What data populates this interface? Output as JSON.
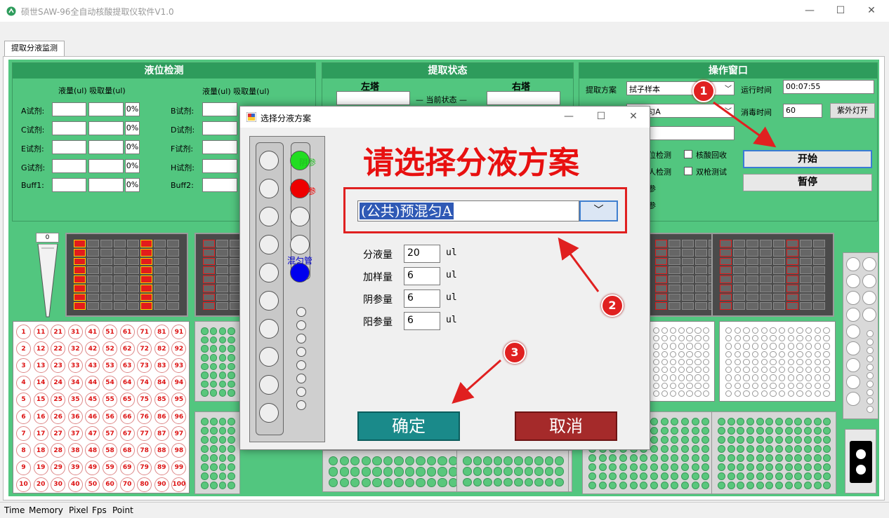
{
  "window": {
    "title": "硕世SAW-96全自动核酸提取仪软件V1.0",
    "min": "—",
    "max": "☐",
    "close": "✕"
  },
  "tabs": [
    {
      "label": "提取分液监测"
    }
  ],
  "liquid": {
    "title": "液位检测",
    "col1_header": "液量(ul) 吸取量(ul)",
    "col2_header": "液量(ul) 吸取量(ul)",
    "left_rows": [
      {
        "label": "A试剂:",
        "pct": "0%"
      },
      {
        "label": "C试剂:",
        "pct": "0%"
      },
      {
        "label": "E试剂:",
        "pct": "0%"
      },
      {
        "label": "G试剂:",
        "pct": "0%"
      },
      {
        "label": "Buff1:",
        "pct": "0%"
      }
    ],
    "right_rows": [
      {
        "label": "B试剂:"
      },
      {
        "label": "D试剂:"
      },
      {
        "label": "F试剂:"
      },
      {
        "label": "H试剂:"
      },
      {
        "label": "Buff2:"
      }
    ]
  },
  "extract": {
    "title": "提取状态",
    "left": "左塔",
    "right": "右塔",
    "state": "— 当前状态 —"
  },
  "ops": {
    "title": "操作窗口",
    "plan_label": "提取方案",
    "plan_value": "拭子样本",
    "runtime_label": "运行时间",
    "runtime_value": "00:07:55",
    "sub_value": ")预混匀A",
    "disinfect_label": "消毒时间",
    "disinfect_value": "60",
    "uv_button": "紫外灯开",
    "start": "开始",
    "pause": "暂停",
    "chk1": "位检测",
    "chk2": "核酸回收",
    "chk3": "人检测",
    "chk4": "双枪测试",
    "frag1": "参",
    "frag2": "参"
  },
  "tip_counter": "0",
  "dialog": {
    "title": "选择分液方案",
    "min": "—",
    "max": "☐",
    "close": "✕",
    "headline": "请选择分液方案",
    "selected": "(公共)预混匀A",
    "fields": [
      {
        "label": "分液量",
        "value": "20",
        "unit": "ul"
      },
      {
        "label": "加样量",
        "value": "6",
        "unit": "ul"
      },
      {
        "label": "阴参量",
        "value": "6",
        "unit": "ul"
      },
      {
        "label": "阳参量",
        "value": "6",
        "unit": "ul"
      }
    ],
    "ok": "确定",
    "cancel": "取消",
    "neg": "阴参",
    "pos": "阳参",
    "mix": "混匀管"
  },
  "markers": [
    "1",
    "2",
    "3"
  ],
  "side_labels": {
    "a": "A",
    "b": "B",
    "c": "C",
    "d": "D",
    "e": "E",
    "f": "F",
    "g": "G",
    "h": "H",
    "buff": "Buff",
    "neg": "阴参",
    "pos": "阳参"
  },
  "row_letters": [
    "A",
    "B",
    "C",
    "D",
    "E",
    "F",
    "G",
    "H"
  ],
  "col_numbers": [
    "1",
    "2",
    "3",
    "4",
    "5",
    "6",
    "7",
    "8",
    "9",
    "10",
    "11",
    "12"
  ],
  "status": {
    "time": "Time",
    "memory": "Memory",
    "pixel": "Pixel",
    "fps": "Fps",
    "point": "Point"
  },
  "colors": {
    "accent_red": "#e02020",
    "panel_green": "#52c67f",
    "ok": "#1a8a8a",
    "cancel": "#a52a2a"
  }
}
